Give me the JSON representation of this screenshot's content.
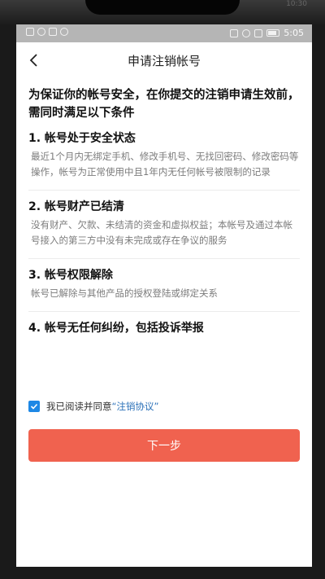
{
  "bezel": {
    "time": "10:30"
  },
  "statusbar": {
    "time": "5:05"
  },
  "navbar": {
    "title": "申请注销帐号"
  },
  "intro": "为保证你的帐号安全，在你提交的注销申请生效前，需同时满足以下条件",
  "conditions": [
    {
      "title": "1. 帐号处于安全状态",
      "desc": "最近1个月内无绑定手机、修改手机号、无找回密码、修改密码等操作，帐号为正常使用中且1年内无任何帐号被限制的记录"
    },
    {
      "title": "2. 帐号财产已结清",
      "desc": "没有财产、欠款、未结清的资金和虚拟权益；本帐号及通过本帐号接入的第三方中没有未完成或存在争议的服务"
    },
    {
      "title": "3. 帐号权限解除",
      "desc": "帐号已解除与其他产品的授权登陆或绑定关系"
    },
    {
      "title": "4. 帐号无任何纠纷，包括投诉举报",
      "desc": ""
    }
  ],
  "agreement": {
    "checked": true,
    "prefix": "我已阅读并同意",
    "link": "“注销协议”"
  },
  "next_button": "下一步",
  "colors": {
    "accent": "#f0624f",
    "checkbox": "#1e88e5",
    "link": "#2a70b8"
  }
}
